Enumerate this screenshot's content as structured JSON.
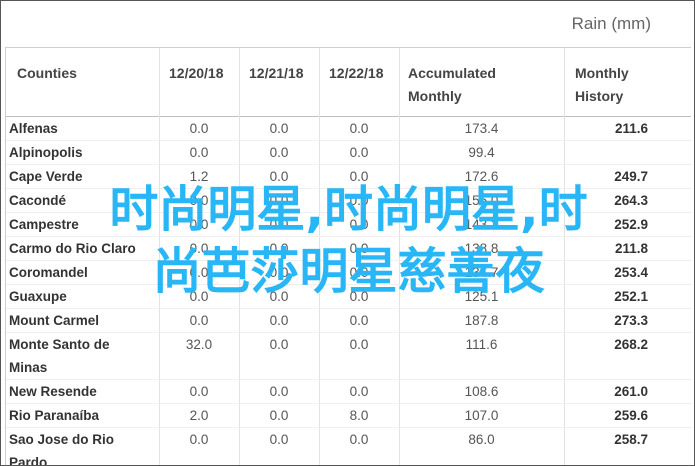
{
  "unit_label": "Rain (mm)",
  "table": {
    "headers": {
      "counties": "Counties",
      "d1": "12/20/18",
      "d2": "12/21/18",
      "d3": "12/22/18",
      "acc1": "Accumulated",
      "acc2": "Monthly",
      "hist1": "Monthly",
      "hist2": "History"
    },
    "rows": [
      {
        "county": [
          "Alfenas"
        ],
        "v1": "0.0",
        "v2": "0.0",
        "v3": "0.0",
        "acc": "173.4",
        "hist": "211.6"
      },
      {
        "county": [
          "Alpinopolis"
        ],
        "v1": "0.0",
        "v2": "0.0",
        "v3": "0.0",
        "acc": "99.4",
        "hist": ""
      },
      {
        "county": [
          "Cape Verde"
        ],
        "v1": "1.2",
        "v2": "0.0",
        "v3": "0.0",
        "acc": "172.6",
        "hist": "249.7"
      },
      {
        "county": [
          "Cacondé"
        ],
        "v1": "0.0",
        "v2": "0.0",
        "v3": "0.0",
        "acc": "156.0",
        "hist": "264.3"
      },
      {
        "county": [
          "Campestre"
        ],
        "v1": "0.0",
        "v2": "0.0",
        "v3": "0.0",
        "acc": "143.2",
        "hist": "252.9"
      },
      {
        "county": [
          "Carmo do Rio Claro"
        ],
        "v1": "0.0",
        "v2": "0.0",
        "v3": "0.0",
        "acc": "138.8",
        "hist": "211.8"
      },
      {
        "county": [
          "Coromandel"
        ],
        "v1": "0.0",
        "v2": "0.0",
        "v3": "0.0",
        "acc": "134.7",
        "hist": "253.4"
      },
      {
        "county": [
          "Guaxupe"
        ],
        "v1": "0.0",
        "v2": "0.0",
        "v3": "0.0",
        "acc": "125.1",
        "hist": "252.1"
      },
      {
        "county": [
          "Mount Carmel"
        ],
        "v1": "0.0",
        "v2": "0.0",
        "v3": "0.0",
        "acc": "187.8",
        "hist": "273.3"
      },
      {
        "county": [
          "Monte Santo de",
          "Minas"
        ],
        "v1": "32.0",
        "v2": "0.0",
        "v3": "0.0",
        "acc": "111.6",
        "hist": "268.2"
      },
      {
        "county": [
          "New Resende"
        ],
        "v1": "0.0",
        "v2": "0.0",
        "v3": "0.0",
        "acc": "108.6",
        "hist": "261.0"
      },
      {
        "county": [
          "Rio Paranaíba"
        ],
        "v1": "2.0",
        "v2": "0.0",
        "v3": "8.0",
        "acc": "107.0",
        "hist": "259.6"
      },
      {
        "county": [
          "Sao Jose do Rio",
          "Pardo"
        ],
        "v1": "0.0",
        "v2": "0.0",
        "v3": "0.0",
        "acc": "86.0",
        "hist": "258.7"
      }
    ]
  },
  "overlay": {
    "line1": "时尚明星,时尚明星,时",
    "line2": "尚芭莎明星慈善夜",
    "color": "#29b6f6"
  }
}
